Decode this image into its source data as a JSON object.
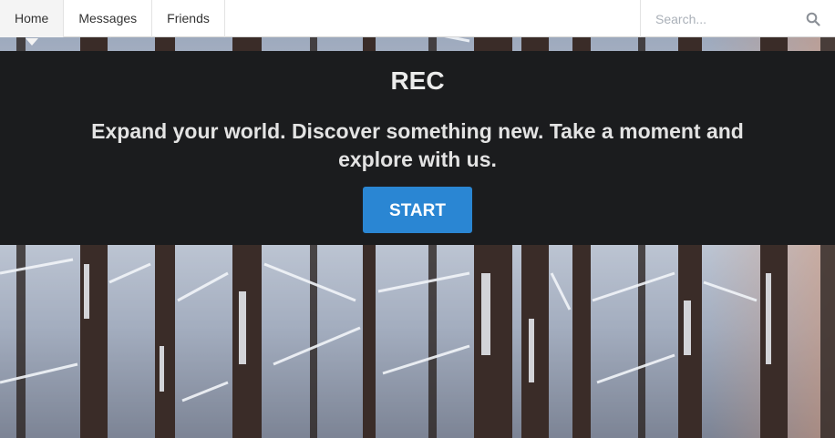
{
  "nav": {
    "tabs": [
      {
        "label": "Home",
        "active": true
      },
      {
        "label": "Messages",
        "active": false
      },
      {
        "label": "Friends",
        "active": false
      }
    ],
    "search": {
      "placeholder": "Search...",
      "icon": "search-icon"
    }
  },
  "hero": {
    "title": "REC",
    "tagline": "Expand your world. Discover something new. Take a moment and explore with us.",
    "button_label": "START"
  },
  "background": {
    "description_icon": "snowy-forest-image"
  },
  "colors": {
    "hero_bg": "#1b1c1e",
    "button": "#2a86d3",
    "navbar": "#ffffff"
  }
}
